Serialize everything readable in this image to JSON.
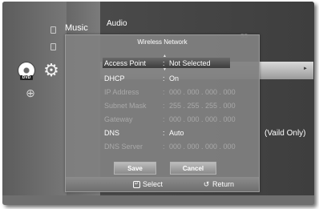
{
  "sidebar": {
    "dvd_label": "DVD",
    "music_label": "Music",
    "audio_label": "Audio"
  },
  "background": {
    "right_text": "(Vaild Only)"
  },
  "dialog": {
    "title": "Wireless Network",
    "rows": [
      {
        "label": "Access Point",
        "value": "Not Selected",
        "state": "selected"
      },
      {
        "label": "DHCP",
        "value": "On",
        "state": "active"
      },
      {
        "label": "IP Address",
        "value": "000 . 000 . 000 . 000",
        "state": "dim"
      },
      {
        "label": "Subnet Mask",
        "value": "255 . 255 . 255 . 000",
        "state": "dim"
      },
      {
        "label": "Gateway",
        "value": "000 . 000 . 000 . 000",
        "state": "dim"
      },
      {
        "label": "DNS",
        "value": "Auto",
        "state": "active"
      },
      {
        "label": "DNS Server",
        "value": "000 . 000 . 000 . 000",
        "state": "dim"
      }
    ],
    "separator": ":",
    "save_label": "Save",
    "cancel_label": "Cancel",
    "hint_select": "Select",
    "hint_return": "Return"
  }
}
